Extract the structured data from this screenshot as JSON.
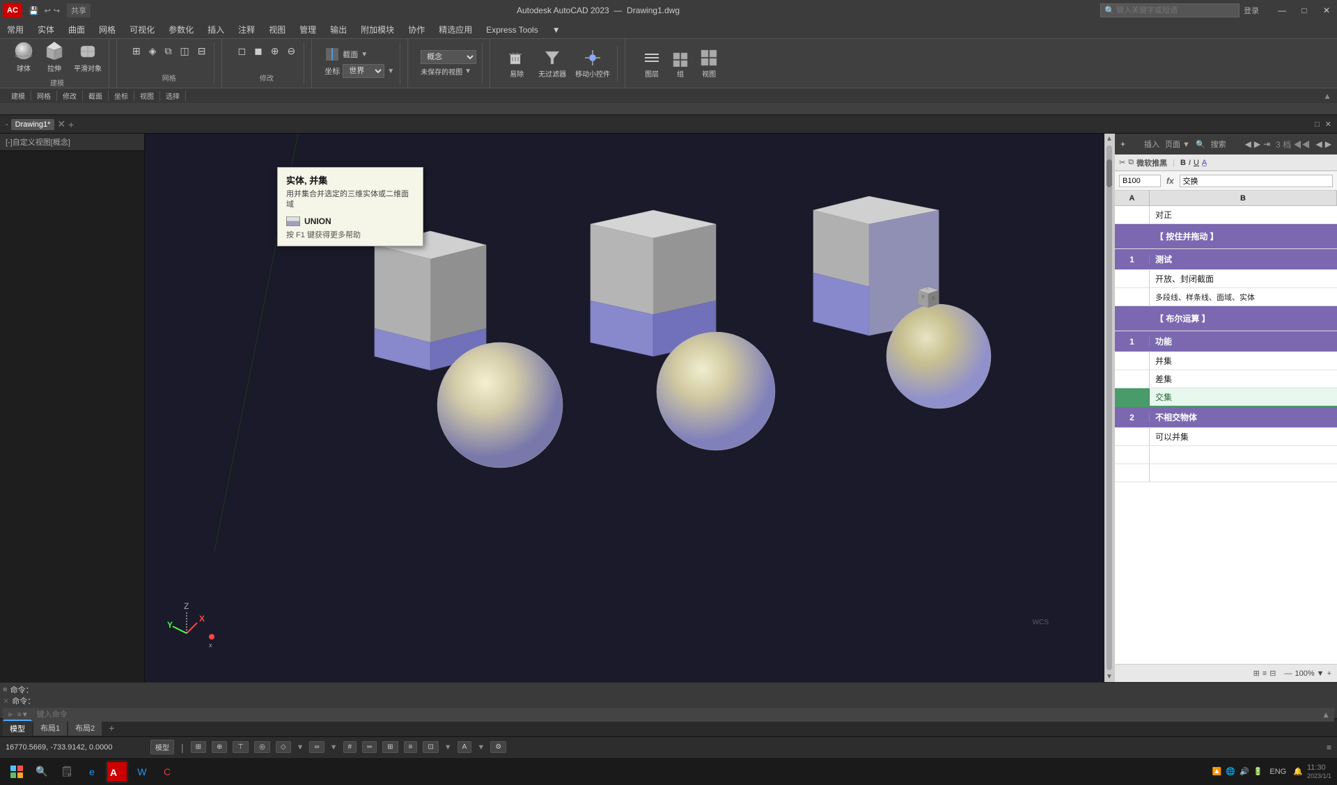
{
  "titleBar": {
    "logo": "AC",
    "appName": "Autodesk AutoCAD 2023",
    "fileName": "Drawing1.dwg",
    "searchPlaceholder": "键入关键字或短语",
    "loginText": "登录",
    "shareText": "共享",
    "undoIcon": "↩",
    "redoIcon": "↪",
    "minBtn": "—",
    "maxBtn": "□",
    "closeBtn": "✕"
  },
  "menuBar": {
    "items": [
      "常用",
      "实体",
      "曲面",
      "网格",
      "可视化",
      "参数化",
      "插入",
      "注释",
      "视图",
      "管理",
      "输出",
      "附加模块",
      "协作",
      "精选应用",
      "Express Tools",
      "▼"
    ]
  },
  "ribbon": {
    "groups": [
      {
        "label": "建模",
        "buttons": [
          {
            "icon": "⊕",
            "label": "球体"
          },
          {
            "icon": "⬛",
            "label": "拉伸"
          },
          {
            "icon": "◎",
            "label": "平滑对象"
          }
        ]
      },
      {
        "label": "网格",
        "buttons": []
      },
      {
        "label": "修改",
        "buttons": []
      },
      {
        "label": "截面",
        "buttons": []
      },
      {
        "label": "坐标",
        "buttons": []
      },
      {
        "label": "视图",
        "buttons": []
      },
      {
        "label": "选择",
        "buttons": []
      }
    ],
    "conceptDropdown": "概念",
    "viewDropdown": "世界",
    "unsavedViewText": "未保存的视图",
    "toolbar": {
      "easyDelete": "易除",
      "filterText": "无过滤器",
      "moveControl": "移动小控件",
      "layerText": "图层",
      "combineText": "组",
      "viewsText": "视图"
    }
  },
  "tooltip": {
    "title": "实体, 并集",
    "desc": "用并集合并选定的三维实体或二维面域",
    "cmdIcon": "▬",
    "cmdText": "UNION",
    "helpText": "按 F1 键获得更多帮助"
  },
  "viewLabel": "[-]自定义视图[概念]",
  "viewport": {
    "viewLabel": "[-]自定义视图[概念]",
    "coords": "16770.5669, -733.9142, 0.0000",
    "modelText": "模型"
  },
  "drawingTabs": {
    "tabs": [
      "模型",
      "布局1",
      "布局2"
    ],
    "addBtn": "+"
  },
  "commandArea": {
    "prompt1": "命令：",
    "prompt2": "命令：",
    "inputPlaceholder": "键入命令",
    "cmdIcon": "►"
  },
  "statusBar": {
    "coords": "16770.5669, -733.9142, 0.0000",
    "modelBtn": "模型",
    "gridBtns": [
      "■■",
      "≡≡",
      "↕"
    ],
    "snapBtns": [
      "□",
      "⊕"
    ],
    "otherBtns": [
      "⚙",
      "≡"
    ]
  },
  "rightPanel": {
    "title": "B",
    "formulaBar": {
      "cellRef": "B100",
      "fxIcon": "fx",
      "formula": "交换"
    },
    "headerCols": [
      "A",
      "B"
    ],
    "rows": [
      {
        "type": "normal",
        "a": "",
        "b": "对正",
        "class": "normal"
      },
      {
        "type": "section",
        "a": "",
        "b": "【 按住并拖动 】",
        "class": "section-blue"
      },
      {
        "type": "numbered",
        "a": "1",
        "b": "测试",
        "class": "numbered-blue"
      },
      {
        "type": "normal",
        "a": "",
        "b": "开放、封闭截面",
        "class": "normal"
      },
      {
        "type": "normal",
        "a": "",
        "b": "多段线、样条线、面域、实体",
        "class": "normal"
      },
      {
        "type": "section",
        "a": "",
        "b": "【 布尔运算 】",
        "class": "section-blue"
      },
      {
        "type": "numbered",
        "a": "1",
        "b": "功能",
        "class": "numbered-blue"
      },
      {
        "type": "normal",
        "a": "",
        "b": "并集",
        "class": "normal"
      },
      {
        "type": "normal",
        "a": "",
        "b": "差集",
        "class": "normal"
      },
      {
        "type": "green",
        "a": "",
        "b": "交集",
        "class": "green-highlight"
      },
      {
        "type": "numbered",
        "a": "2",
        "b": "不相交物体",
        "class": "numbered-blue"
      },
      {
        "type": "normal",
        "a": "",
        "b": "可以并集",
        "class": "normal"
      }
    ]
  },
  "taskbar": {
    "startBtn": "⊞",
    "icons": [
      "🗒",
      "e",
      "AC",
      "W",
      "C"
    ],
    "trayIcons": [
      "🔔",
      "🔊",
      "🌐",
      "ENG",
      "⬜"
    ]
  }
}
